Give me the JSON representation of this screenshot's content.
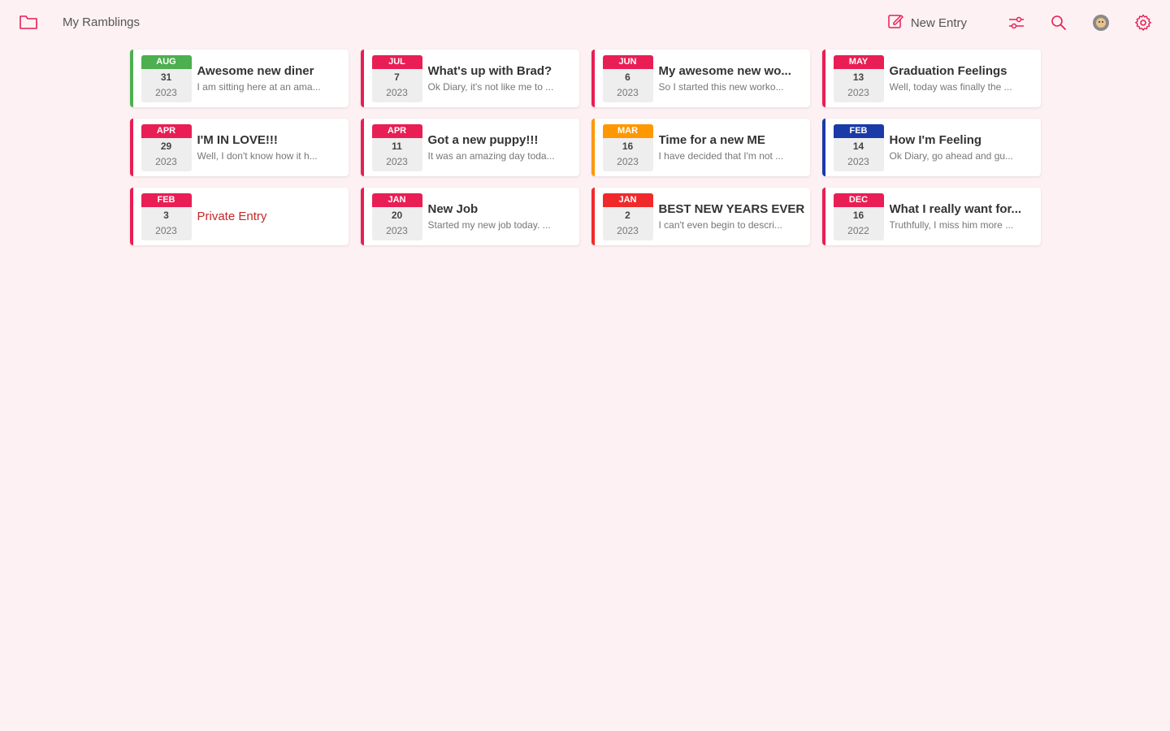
{
  "app": {
    "title": "My Ramblings",
    "accent": "#e91e54"
  },
  "toolbar": {
    "new_entry_label": "New Entry",
    "icons": [
      "folder-icon",
      "edit-icon",
      "sliders-icon",
      "search-icon",
      "avatar-icon",
      "gear-icon"
    ]
  },
  "entries": [
    {
      "month": "AUG",
      "day": "31",
      "year": "2023",
      "title": "Awesome new diner",
      "preview": "I am sitting here at an ama...",
      "color": "#4caf50"
    },
    {
      "month": "JUL",
      "day": "7",
      "year": "2023",
      "title": "What's up with Brad?",
      "preview": "Ok Diary, it's not like me to ...",
      "color": "#e91e54"
    },
    {
      "month": "JUN",
      "day": "6",
      "year": "2023",
      "title": "My awesome new wo...",
      "preview": "So I started this new worko...",
      "color": "#e91e54"
    },
    {
      "month": "MAY",
      "day": "13",
      "year": "2023",
      "title": "Graduation Feelings",
      "preview": "Well, today was finally the ...",
      "color": "#e91e54"
    },
    {
      "month": "APR",
      "day": "29",
      "year": "2023",
      "title": "I'M IN LOVE!!!",
      "preview": "Well, I don't know how it h...",
      "color": "#e91e54"
    },
    {
      "month": "APR",
      "day": "11",
      "year": "2023",
      "title": "Got a new puppy!!!",
      "preview": "It was an amazing day toda...",
      "color": "#e91e54"
    },
    {
      "month": "MAR",
      "day": "16",
      "year": "2023",
      "title": "Time for a new ME",
      "preview": "I have decided that I'm not ...",
      "color": "#ff9800"
    },
    {
      "month": "FEB",
      "day": "14",
      "year": "2023",
      "title": "How I'm Feeling",
      "preview": "Ok Diary, go ahead and gu...",
      "color": "#1a3aa8"
    },
    {
      "month": "FEB",
      "day": "3",
      "year": "2023",
      "title": "Private Entry",
      "preview": "",
      "color": "#e91e54",
      "private": true
    },
    {
      "month": "JAN",
      "day": "20",
      "year": "2023",
      "title": "New Job",
      "preview": "Started my new job today. ...",
      "color": "#e91e54"
    },
    {
      "month": "JAN",
      "day": "2",
      "year": "2023",
      "title": "BEST NEW YEARS EVER",
      "preview": "I can't even begin to descri...",
      "color": "#f02a2a"
    },
    {
      "month": "DEC",
      "day": "16",
      "year": "2022",
      "title": "What I really want for...",
      "preview": "Truthfully, I miss him more ...",
      "color": "#e91e54"
    }
  ]
}
